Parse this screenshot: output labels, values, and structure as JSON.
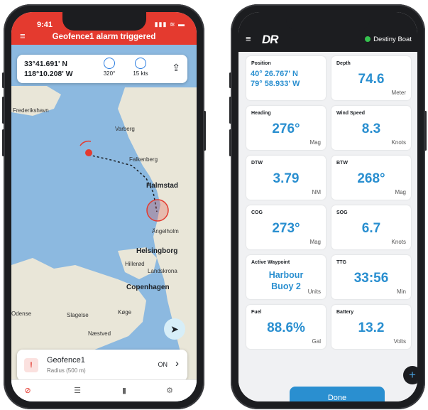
{
  "left_phone": {
    "status_time": "9:41",
    "alarm_title": "Geofence1 alarm triggered",
    "position": {
      "lat": "33°41.691' N",
      "lon": "118°10.208' W"
    },
    "heading": "320°",
    "speed": "15 kts",
    "map_labels": [
      "Frederikshavn",
      "Varberg",
      "Falkenberg",
      "Halmstad",
      "Ängelholm",
      "Helsingborg",
      "Hillerød",
      "Landskrona",
      "Copenhagen",
      "Slagelse",
      "Køge",
      "Næstved",
      "Odense"
    ],
    "geofence": {
      "name": "Geofence1",
      "radius": "Radius (500 m)",
      "state": "ON"
    },
    "icons": [
      "menu-icon",
      "compass-icon",
      "speedometer-icon",
      "share-icon",
      "navigation-arrow-icon",
      "warning-icon",
      "chevron-right-icon",
      "map-tab-icon",
      "settings-tab-icon",
      "stats-tab-icon",
      "gear-tab-icon"
    ],
    "alarm_color": "#e43a2f"
  },
  "right_phone": {
    "brand": "DR",
    "boat_name": "Destiny Boat",
    "cards": [
      {
        "label": "Position",
        "value": "40° 26.767' N\n79° 58.933' W",
        "unit": ""
      },
      {
        "label": "Depth",
        "value": "74.6",
        "unit": "Meter"
      },
      {
        "label": "Heading",
        "value": "276°",
        "unit": "Mag"
      },
      {
        "label": "Wind Speed",
        "value": "8.3",
        "unit": "Knots"
      },
      {
        "label": "DTW",
        "value": "3.79",
        "unit": "NM"
      },
      {
        "label": "BTW",
        "value": "268°",
        "unit": "Mag"
      },
      {
        "label": "COG",
        "value": "273°",
        "unit": "Mag"
      },
      {
        "label": "SOG",
        "value": "6.7",
        "unit": "Knots"
      },
      {
        "label": "Active Waypoint",
        "value": "Harbour\nBuoy 2",
        "unit": "Units"
      },
      {
        "label": "TTG",
        "value": "33:56",
        "unit": "Min"
      },
      {
        "label": "Fuel",
        "value": "88.6%",
        "unit": "Gal"
      },
      {
        "label": "Battery",
        "value": "13.2",
        "unit": "Volts"
      }
    ],
    "done_label": "Done",
    "accent_color": "#2a8fd0",
    "online_color": "#35c24e"
  }
}
